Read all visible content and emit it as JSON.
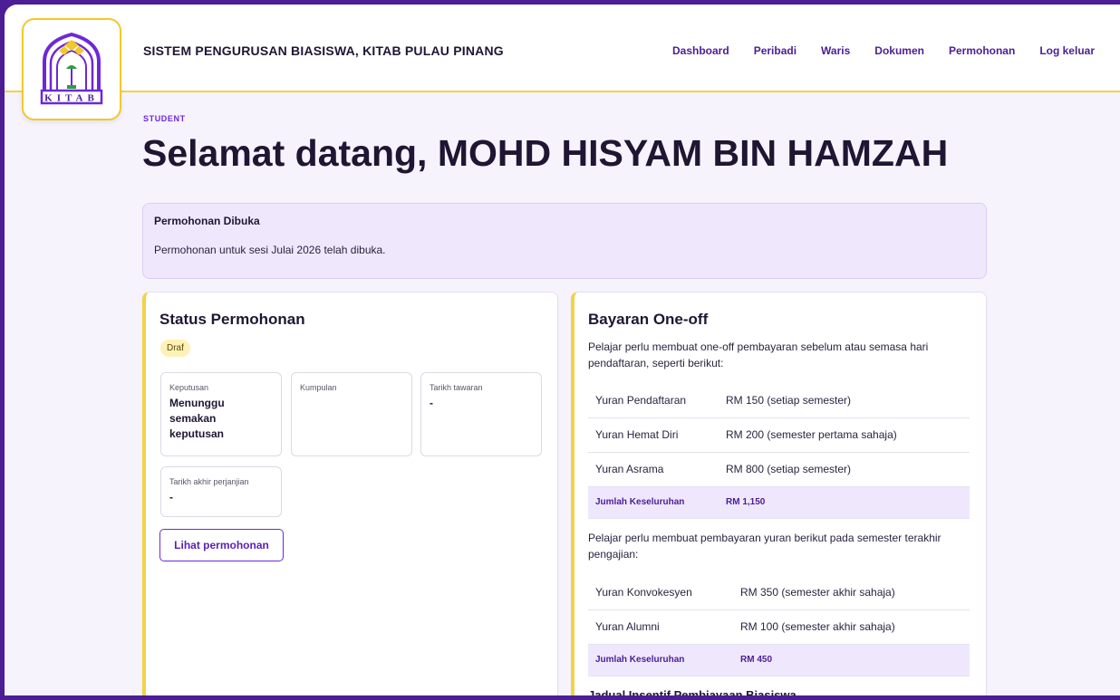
{
  "header": {
    "app_title": "SISTEM PENGURUSAN BIASISWA, KITAB PULAU PINANG",
    "logo_text": "KITAB",
    "nav": [
      {
        "label": "Dashboard"
      },
      {
        "label": "Peribadi"
      },
      {
        "label": "Waris"
      },
      {
        "label": "Dokumen"
      },
      {
        "label": "Permohonan"
      },
      {
        "label": "Log keluar"
      }
    ]
  },
  "page": {
    "role": "STUDENT",
    "welcome": "Selamat datang, MOHD HISYAM BIN HAMZAH"
  },
  "notice": {
    "title": "Permohonan Dibuka",
    "body": "Permohonan untuk sesi Julai 2026 telah dibuka."
  },
  "status_card": {
    "title": "Status Permohonan",
    "badge": "Draf",
    "tiles": [
      {
        "label": "Keputusan",
        "value": "Menunggu semakan keputusan"
      },
      {
        "label": "Kumpulan",
        "value": ""
      },
      {
        "label": "Tarikh tawaran",
        "value": "-"
      },
      {
        "label": "Tarikh akhir perjanjian",
        "value": "-"
      }
    ],
    "button": "Lihat permohonan"
  },
  "payment_card": {
    "title": "Bayaran One-off",
    "intro1": "Pelajar perlu membuat one-off pembayaran sebelum atau semasa hari pendaftaran, seperti berikut:",
    "table1": [
      {
        "item": "Yuran Pendaftaran",
        "amount": "RM 150 (setiap semester)"
      },
      {
        "item": "Yuran Hemat Diri",
        "amount": "RM 200 (semester pertama sahaja)"
      },
      {
        "item": "Yuran Asrama",
        "amount": "RM 800 (setiap semester)"
      }
    ],
    "total1": {
      "label": "Jumlah Keseluruhan",
      "amount": "RM 1,150"
    },
    "intro2": "Pelajar perlu membuat pembayaran yuran berikut pada semester terakhir pengajian:",
    "table2": [
      {
        "item": "Yuran Konvokesyen",
        "amount": "RM 350 (semester akhir sahaja)"
      },
      {
        "item": "Yuran Alumni",
        "amount": "RM 100 (semester akhir sahaja)"
      }
    ],
    "total2": {
      "label": "Jumlah Keseluruhan",
      "amount": "RM 450"
    },
    "next_section": "Jadual Insentif Pembiayaan Biasiswa"
  },
  "colors": {
    "accent": "#4c1d95",
    "highlight": "#f1d34a",
    "notice_bg": "#efe8fd"
  }
}
